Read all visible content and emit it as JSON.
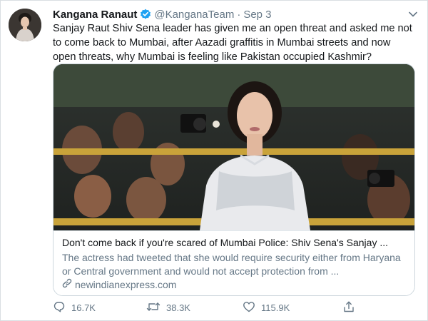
{
  "tweet": {
    "author_name": "Kangana Ranaut",
    "handle": "@KanganaTeam",
    "separator": "·",
    "date": "Sep 3",
    "verified_icon": "verified-badge-icon",
    "text": "Sanjay Raut Shiv Sena leader has given me an open threat and asked me not to come back to Mumbai, after Aazadi graffitis in Mumbai streets and now open threats, why Mumbai is feeling like Pakistan occupied Kashmir?"
  },
  "card": {
    "title": "Don't come back if you're scared of Mumbai Police: Shiv Sena's Sanjay ...",
    "description": "The actress had tweeted that she would require security either from Haryana or Central government and would not accept protection from ...",
    "domain": "newindianexpress.com"
  },
  "actions": {
    "reply_count": "16.7K",
    "retweet_count": "38.3K",
    "like_count": "115.9K"
  },
  "colors": {
    "accent": "#1da1f2",
    "secondary_text": "#657786",
    "border": "#ccd6dd"
  }
}
